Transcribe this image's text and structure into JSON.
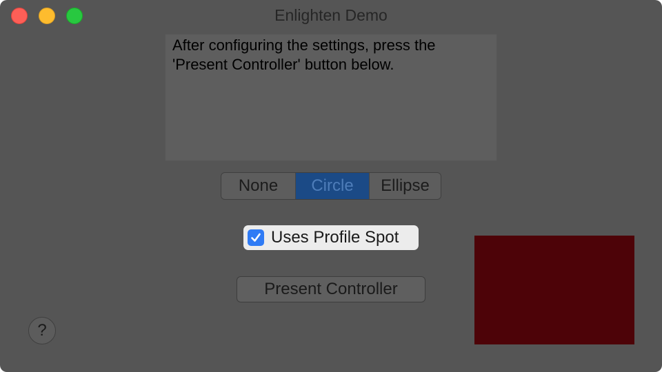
{
  "window": {
    "title": "Enlighten Demo"
  },
  "instructions": {
    "text": "After configuring the settings, press the 'Present Controller' button below."
  },
  "shape_selector": {
    "options": [
      "None",
      "Circle",
      "Ellipse"
    ],
    "selected": "Circle"
  },
  "profile_spot": {
    "label": "Uses Profile Spot",
    "checked": true
  },
  "present_button": {
    "label": "Present Controller"
  },
  "help_button": {
    "label": "?"
  },
  "preview": {
    "color": "#4d0308"
  },
  "colors": {
    "window_bg": "#555555",
    "accent": "#2f7bf5",
    "selected_segment": "#1b4a86"
  }
}
